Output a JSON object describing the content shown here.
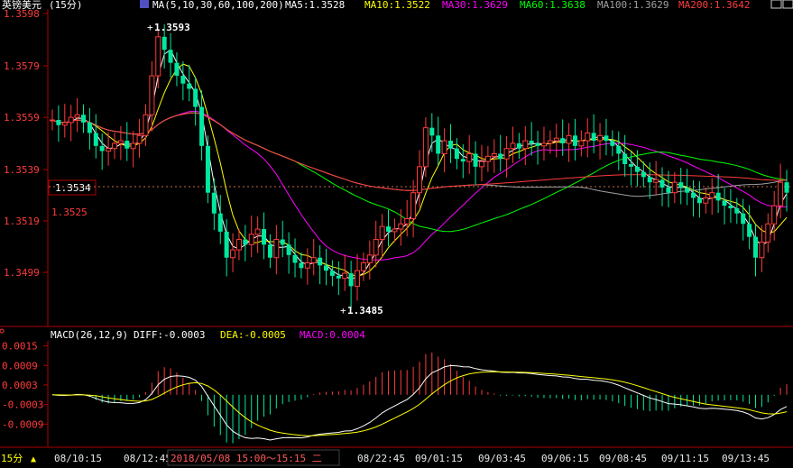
{
  "header": {
    "symbol": "英镑美元",
    "period": "(15分)",
    "ma_label": "MA(5,10,30,60,100,200)",
    "ma_values": [
      {
        "label": "MA5:1.3528",
        "color": "#ffffff"
      },
      {
        "label": "MA10:1.3522",
        "color": "#ffff00"
      },
      {
        "label": "MA30:1.3629",
        "color": "#ff00ff"
      },
      {
        "label": "MA60:1.3638",
        "color": "#00ff00"
      },
      {
        "label": "MA100:1.3629",
        "color": "#a0a0a0"
      },
      {
        "label": "MA200:1.3642",
        "color": "#ff3b3b"
      }
    ]
  },
  "price_axis": {
    "ticks": [
      "1.3598",
      "1.3579",
      "1.3559",
      "1.3539",
      "1.3519",
      "1.3499"
    ],
    "current_price": "1.3534",
    "cursor_price": "1.3525"
  },
  "annotations": {
    "high": "1.3593",
    "low": "1.3485"
  },
  "macd_header": {
    "label": "MACD(26,12,9)",
    "diff": "DIFF:-0.0003",
    "dea": "DEA:-0.0005",
    "macd": "MACD:0.0004"
  },
  "macd_axis": {
    "ticks": [
      "0.0015",
      "0.0009",
      "0.0003",
      "-0.0003",
      "-0.0009"
    ]
  },
  "time_axis": {
    "period_button": "15分",
    "labels": [
      "08/10:15",
      "08/12:45",
      "2018/05/08 15:00～15:15 二",
      "08/22:45",
      "09/01:15",
      "09/03:45",
      "09/06:15",
      "09/08:45",
      "09/11:15",
      "09/13:45"
    ]
  },
  "colors": {
    "up": "#ff3b3b",
    "down": "#00e8a0",
    "axis": "#b00000",
    "ma5": "#ffffff",
    "ma10": "#ffff00",
    "ma30": "#ff00ff",
    "ma60": "#00ff00",
    "ma100": "#a0a0a0",
    "ma200": "#ff3b3b"
  },
  "chart_data": {
    "type": "candlestick",
    "y_range": [
      1.3482,
      1.36
    ],
    "macd_range": [
      -0.0015,
      0.0016
    ],
    "closes": [
      1.3558,
      1.3556,
      1.3557,
      1.3559,
      1.356,
      1.3557,
      1.3553,
      1.3548,
      1.3546,
      1.3547,
      1.3549,
      1.355,
      1.3547,
      1.3549,
      1.3552,
      1.356,
      1.3575,
      1.359,
      1.3585,
      1.358,
      1.3575,
      1.3572,
      1.357,
      1.3563,
      1.3548,
      1.353,
      1.3522,
      1.3515,
      1.3505,
      1.3508,
      1.3512,
      1.351,
      1.3514,
      1.3516,
      1.351,
      1.3505,
      1.3512,
      1.351,
      1.3506,
      1.3503,
      1.3501,
      1.3503,
      1.3505,
      1.3502,
      1.35,
      1.3498,
      1.3497,
      1.3499,
      1.3494,
      1.35,
      1.3503,
      1.3506,
      1.3512,
      1.3517,
      1.3515,
      1.3516,
      1.3518,
      1.352,
      1.353,
      1.354,
      1.3555,
      1.3552,
      1.3545,
      1.355,
      1.3547,
      1.3543,
      1.3542,
      1.3545,
      1.354,
      1.3542,
      1.3544,
      1.3545,
      1.3543,
      1.3547,
      1.3549,
      1.3547,
      1.355,
      1.3549,
      1.3548,
      1.3549,
      1.355,
      1.3551,
      1.3549,
      1.3552,
      1.3548,
      1.355,
      1.3553,
      1.355,
      1.3552,
      1.355,
      1.3548,
      1.3545,
      1.3541,
      1.354,
      1.3538,
      1.3536,
      1.3534,
      1.3535,
      1.3532,
      1.353,
      1.3534,
      1.3532,
      1.353,
      1.3528,
      1.3526,
      1.3528,
      1.353,
      1.3527,
      1.3525,
      1.3524,
      1.3522,
      1.3518,
      1.3513,
      1.3505,
      1.3511,
      1.3518,
      1.3525,
      1.3534,
      1.353
    ]
  }
}
